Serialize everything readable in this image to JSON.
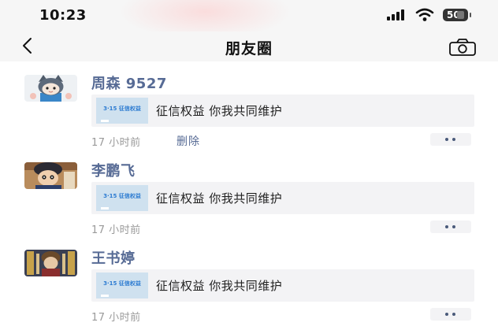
{
  "status_bar": {
    "time": "10:23",
    "battery_level": "50",
    "icons": [
      "cellular-signal-icon",
      "wifi-icon",
      "battery-icon"
    ]
  },
  "nav": {
    "title": "朋友圈",
    "back_icon": "chevron-left-icon",
    "camera_icon": "camera-icon"
  },
  "posts": [
    {
      "username": "周森 9527",
      "share_thumb_text": "3·15 征信权益",
      "share_title": "征信权益 你我共同维护",
      "time_ago": "17 小时前",
      "delete_label": "删除"
    },
    {
      "username": "李鹏飞",
      "share_thumb_text": "3·15 征信权益",
      "share_title": "征信权益 你我共同维护",
      "time_ago": "17 小时前"
    },
    {
      "username": "王书婷",
      "share_thumb_text": "3·15 征信权益",
      "share_title": "征信权益 你我共同维护",
      "time_ago": "17 小时前"
    }
  ],
  "colors": {
    "username": "#576b95",
    "bar_bg": "#f6f6f6",
    "card_bg": "#f3f3f5",
    "meta_text": "#9a9a9a"
  }
}
